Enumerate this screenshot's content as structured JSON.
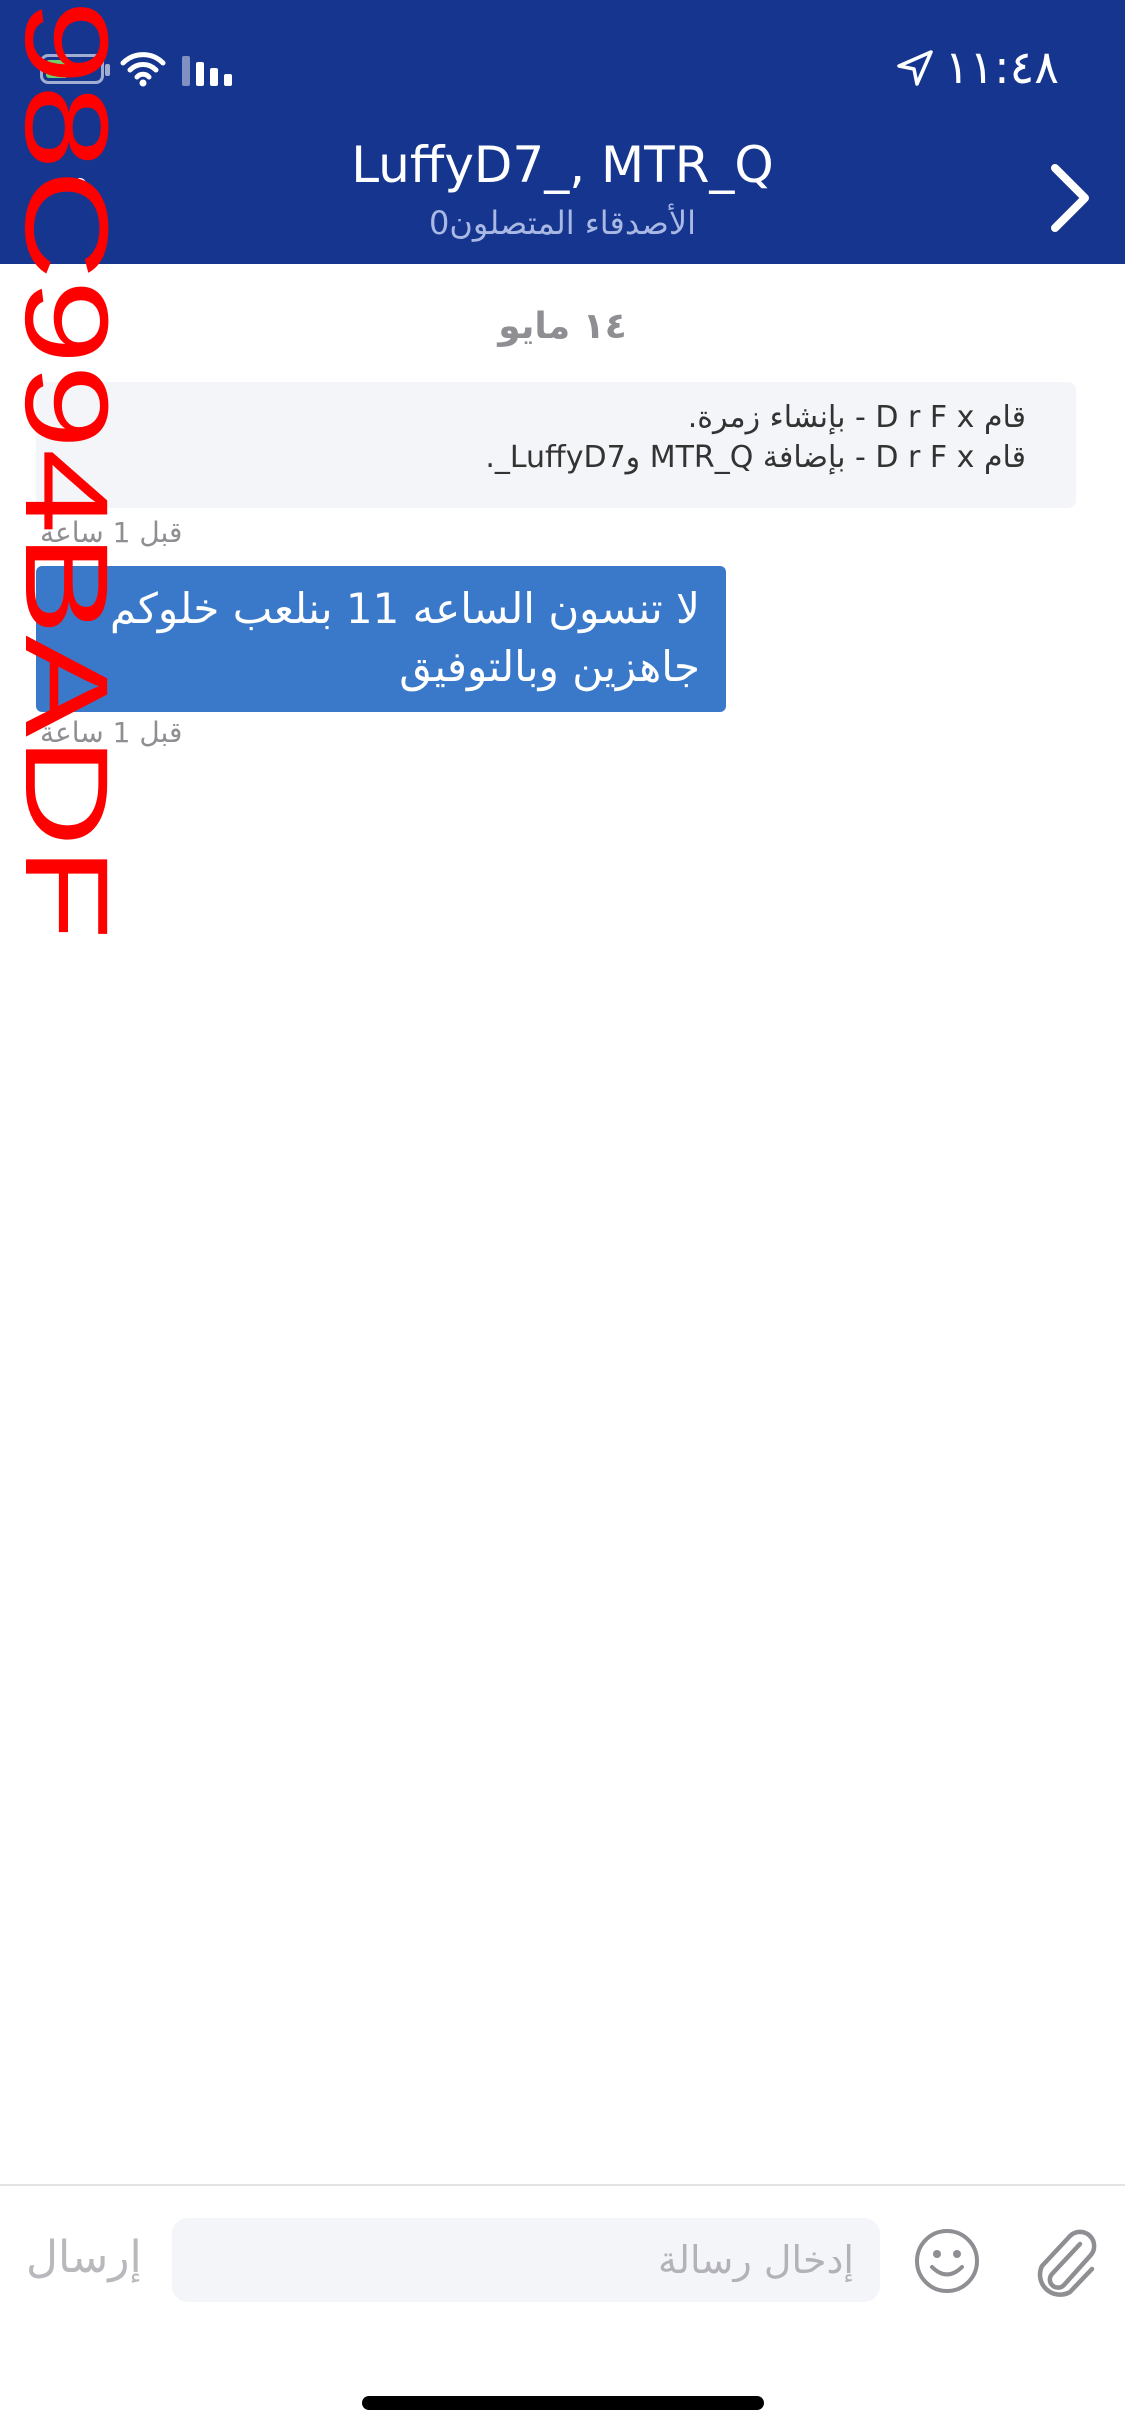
{
  "status_bar": {
    "time": "١١:٤٨",
    "icons": [
      "battery-icon",
      "wifi-icon",
      "signal-icon",
      "location-arrow-icon"
    ]
  },
  "header": {
    "title": "LuffyD7_, MTR_Q",
    "subtitle": "الأصدقاء المتصلون0",
    "settings_glyph": "°",
    "back_icon": "chevron-right-icon",
    "background_color": "#16358f"
  },
  "chat": {
    "date_label": "١٤ مايو",
    "system_messages": [
      "قام D r F x - بإنشاء زمرة.",
      "قام D r F x - بإضافة MTR_Q وLuffyD7_."
    ],
    "system_timestamp": "قبل 1 ساعة",
    "message": {
      "lines": [
        "لا تنسون الساعه 11 بنلعب خلوكم",
        "جاهزين وبالتوفيق"
      ],
      "timestamp": "قبل 1 ساعة",
      "bubble_color": "#3a79c9"
    }
  },
  "composer": {
    "send_label": "إرسال",
    "input_placeholder": "إدخال رسالة",
    "input_value": "",
    "emoji_icon": "smiley-icon",
    "attach_icon": "paperclip-icon"
  },
  "watermark": {
    "text": "98C994BADF",
    "color": "#ff0000"
  }
}
